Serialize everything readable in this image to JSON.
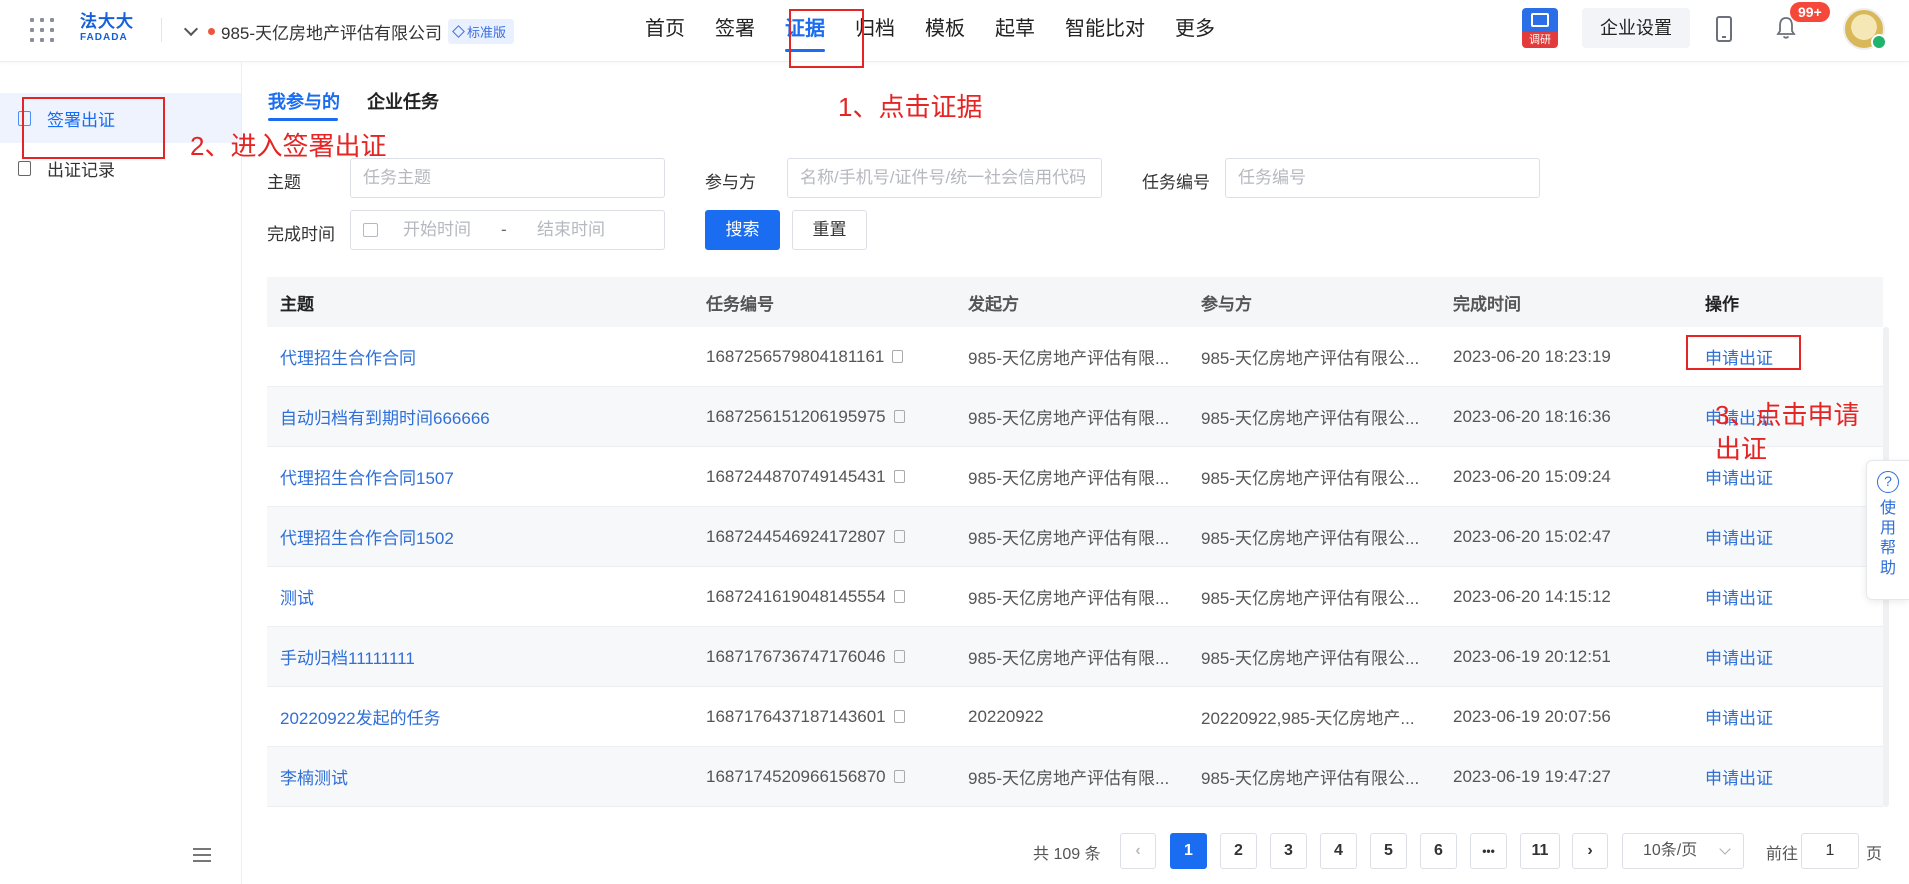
{
  "header": {
    "logo_cn": "法大大",
    "logo_en": "FADADA",
    "company": "985-天亿房地产评估有限公司",
    "plan_badge": "标准版",
    "nav": [
      "首页",
      "签署",
      "证据",
      "归档",
      "模板",
      "起草",
      "智能比对",
      "更多"
    ],
    "active_nav": "证据",
    "survey_label": "调研",
    "settings_label": "企业设置",
    "notification_count": "99+"
  },
  "sidebar": {
    "items": [
      {
        "label": "签署出证",
        "active": true
      },
      {
        "label": "出证记录",
        "active": false
      }
    ]
  },
  "tabs": [
    "我参与的",
    "企业任务"
  ],
  "filters": {
    "subject_label": "主题",
    "subject_placeholder": "任务主题",
    "party_label": "参与方",
    "party_placeholder": "名称/手机号/证件号/统一社会信用代码",
    "taskno_label": "任务编号",
    "taskno_placeholder": "任务编号",
    "time_label": "完成时间",
    "start_placeholder": "开始时间",
    "range_sep": "-",
    "end_placeholder": "结束时间",
    "search_btn": "搜索",
    "reset_btn": "重置"
  },
  "table": {
    "columns": [
      "主题",
      "任务编号",
      "发起方",
      "参与方",
      "完成时间",
      "操作"
    ],
    "rows": [
      {
        "subject": "代理招生合作合同",
        "taskno": "1687256579804181161",
        "initiator": "985-天亿房地产评估有限...",
        "party": "985-天亿房地产评估有限公...",
        "time": "2023-06-20 18:23:19",
        "action": "申请出证"
      },
      {
        "subject": "自动归档有到期时间666666",
        "taskno": "1687256151206195975",
        "initiator": "985-天亿房地产评估有限...",
        "party": "985-天亿房地产评估有限公...",
        "time": "2023-06-20 18:16:36",
        "action": "申请出证"
      },
      {
        "subject": "代理招生合作合同1507",
        "taskno": "1687244870749145431",
        "initiator": "985-天亿房地产评估有限...",
        "party": "985-天亿房地产评估有限公...",
        "time": "2023-06-20 15:09:24",
        "action": "申请出证"
      },
      {
        "subject": "代理招生合作合同1502",
        "taskno": "1687244546924172807",
        "initiator": "985-天亿房地产评估有限...",
        "party": "985-天亿房地产评估有限公...",
        "time": "2023-06-20 15:02:47",
        "action": "申请出证"
      },
      {
        "subject": "测试",
        "taskno": "1687241619048145554",
        "initiator": "985-天亿房地产评估有限...",
        "party": "985-天亿房地产评估有限公...",
        "time": "2023-06-20 14:15:12",
        "action": "申请出证"
      },
      {
        "subject": "手动归档11111111",
        "taskno": "1687176736747176046",
        "initiator": "985-天亿房地产评估有限...",
        "party": "985-天亿房地产评估有限公...",
        "time": "2023-06-19 20:12:51",
        "action": "申请出证"
      },
      {
        "subject": "20220922发起的任务",
        "taskno": "1687176437187143601",
        "initiator": "20220922",
        "party": "20220922,985-天亿房地产...",
        "time": "2023-06-19 20:07:56",
        "action": "申请出证"
      },
      {
        "subject": "李楠测试",
        "taskno": "1687174520966156870",
        "initiator": "985-天亿房地产评估有限...",
        "party": "985-天亿房地产评估有限公...",
        "time": "2023-06-19 19:47:27",
        "action": "申请出证"
      }
    ]
  },
  "pagination": {
    "total": "共 109 条",
    "pages": [
      "1",
      "2",
      "3",
      "4",
      "5",
      "6",
      "•••",
      "11"
    ],
    "current": "1",
    "page_size": "10条/页",
    "goto_prefix": "前往",
    "goto_value": "1",
    "goto_suffix": "页"
  },
  "help": {
    "label": "使用帮助",
    "icon": "?"
  },
  "annotations": {
    "step1": "1、点击证据",
    "step2": "2、进入签署出证",
    "step3": "3、点击申请出证"
  },
  "colors": {
    "accent": "#1a6cf0",
    "annotation": "#e52424"
  }
}
